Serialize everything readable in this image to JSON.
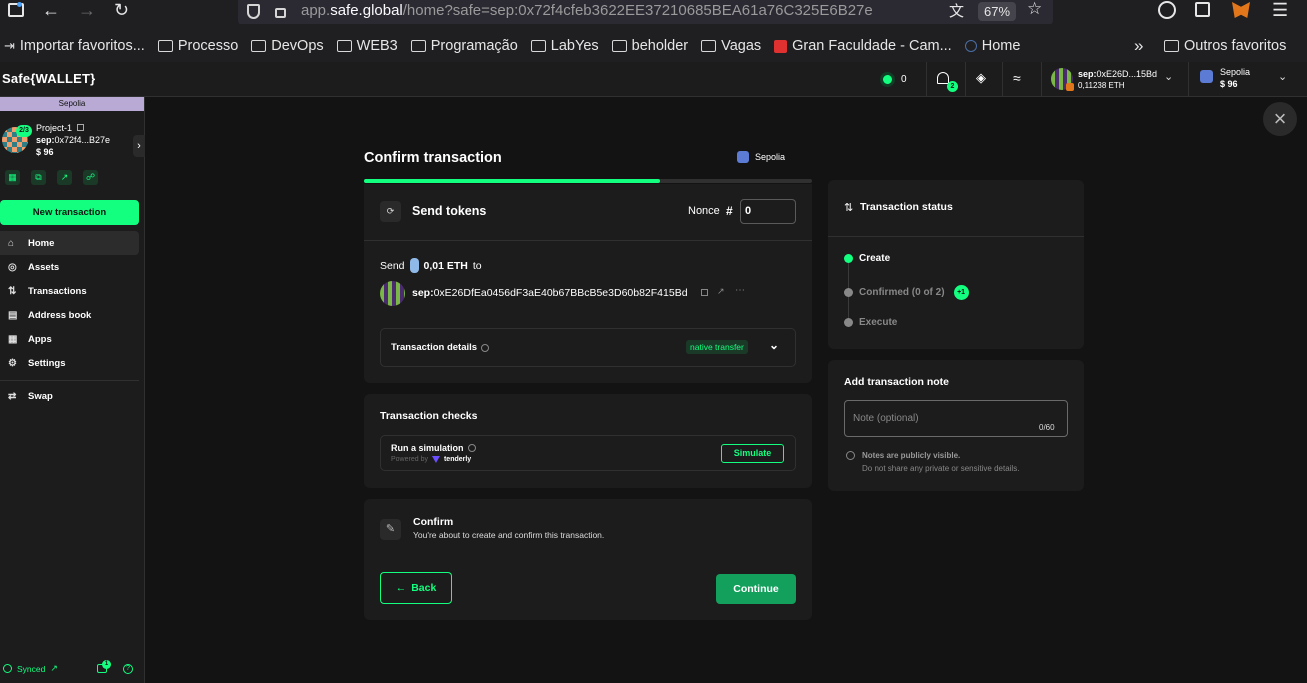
{
  "browser": {
    "url_base": "app.",
    "url_domain": "safe.global",
    "url_path": "/home?safe=sep:0x72f4cfeb3622EE37210685BEA61a76C325E6B27e",
    "zoom": "67%",
    "bookmarks": [
      {
        "label": "Importar favoritos...",
        "icon": "import-icon"
      },
      {
        "label": "Processo",
        "icon": "folder-icon"
      },
      {
        "label": "DevOps",
        "icon": "folder-icon"
      },
      {
        "label": "WEB3",
        "icon": "folder-icon"
      },
      {
        "label": "Programação",
        "icon": "folder-icon"
      },
      {
        "label": "LabYes",
        "icon": "folder-icon"
      },
      {
        "label": "beholder",
        "icon": "folder-icon"
      },
      {
        "label": "Vagas",
        "icon": "folder-icon"
      },
      {
        "label": "Gran Faculdade - Cam...",
        "icon": "gran-icon"
      },
      {
        "label": "Home",
        "icon": "globe-icon"
      }
    ],
    "other_bookmarks": "Outros favoritos"
  },
  "app": {
    "logo": "Safe{WALLET}",
    "header": {
      "tx_count": "0",
      "notif_badge": "2",
      "account_addr_prefix": "sep:",
      "account_addr": "0xE26D...15Bd",
      "account_balance": "0,11238 ETH",
      "network": "Sepolia",
      "network_balance": "$ 96"
    }
  },
  "sidebar": {
    "network_label": "Sepolia",
    "threshold": "2/3",
    "safe_name": "Project-1",
    "safe_addr_prefix": "sep:",
    "safe_addr": "0x72f4...B27e",
    "safe_balance": "$ 96",
    "new_tx": "New transaction",
    "nav": [
      {
        "label": "Home",
        "icon": "home-icon"
      },
      {
        "label": "Assets",
        "icon": "assets-icon"
      },
      {
        "label": "Transactions",
        "icon": "transactions-icon"
      },
      {
        "label": "Address book",
        "icon": "address-book-icon"
      },
      {
        "label": "Apps",
        "icon": "apps-icon"
      },
      {
        "label": "Settings",
        "icon": "settings-icon"
      }
    ],
    "swap": "Swap",
    "synced": "Synced",
    "bottom_badge": "1"
  },
  "modal": {
    "title": "Confirm transaction",
    "network": "Sepolia",
    "progress": 0.66,
    "send_card": {
      "title": "Send tokens",
      "nonce_label": "Nonce",
      "nonce_hash": "#",
      "nonce_value": "0",
      "send_label": "Send",
      "amount": "0,01 ETH",
      "to_label": "to",
      "recipient_prefix": "sep:",
      "recipient": "0xE26DfEa0456dF3aE40b67BBcB5e3D60b82F415Bd",
      "details_label": "Transaction details",
      "details_tag": "native transfer"
    },
    "checks_card": {
      "title": "Transaction checks",
      "sim_label": "Run a simulation",
      "powered_by": "Powered by",
      "provider": "tenderly",
      "simulate": "Simulate"
    },
    "confirm_card": {
      "title": "Confirm",
      "subtitle": "You're about to create and confirm this transaction.",
      "back": "Back",
      "continue": "Continue"
    },
    "status_card": {
      "title": "Transaction status",
      "steps": [
        {
          "label": "Create",
          "state": "active"
        },
        {
          "label": "Confirmed (0 of 2)",
          "state": "pending"
        },
        {
          "label": "Execute",
          "state": "pending"
        }
      ],
      "confirm_badge": "+1"
    },
    "note_card": {
      "title": "Add transaction note",
      "placeholder": "Note (optional)",
      "counter": "0/60",
      "hint_title": "Notes are publicly visible.",
      "hint_body": "Do not share any private or sensitive details."
    }
  },
  "colors": {
    "accent": "#12ff80",
    "bg": "#121312",
    "panel": "#1c1c1c",
    "sepolia": "#b8aad4"
  }
}
